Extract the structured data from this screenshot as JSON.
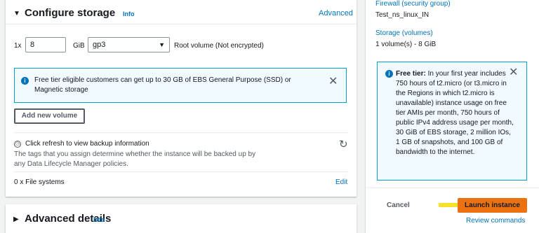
{
  "storage": {
    "title": "Configure storage",
    "info": "Info",
    "advanced_link": "Advanced",
    "volume_count": "1x",
    "volume_size": "8",
    "size_unit": "GiB",
    "volume_type": "gp3",
    "volume_desc": "Root volume  (Not encrypted)",
    "alert_text": "Free tier eligible customers can get up to 30 GB of EBS General Purpose (SSD) or Magnetic storage",
    "add_volume_button": "Add new volume",
    "backup_title": "Click refresh to view backup information",
    "backup_desc": "The tags that you assign determine whether the instance will be backed up by any Data Lifecycle Manager policies.",
    "file_systems": "0 x File systems",
    "edit_link": "Edit"
  },
  "advanced_details": {
    "title": "Advanced details",
    "info": "Info"
  },
  "summary": {
    "firewall_label": "Firewall (security group)",
    "firewall_value": "Test_ns_linux_IN",
    "storage_label": "Storage (volumes)",
    "storage_value": "1 volume(s) - 8 GiB",
    "free_tier_label": "Free tier:",
    "free_tier_text": " In your first year includes 750 hours of t2.micro (or t3.micro in the Regions in which t2.micro is unavailable) instance usage on free tier AMIs per month, 750 hours of public IPv4 address usage per month, 30 GiB of EBS storage, 2 million IOs, 1 GB of snapshots, and 100 GB of bandwidth to the internet.",
    "cancel_button": "Cancel",
    "launch_button": "Launch instance",
    "review_link": "Review commands"
  }
}
